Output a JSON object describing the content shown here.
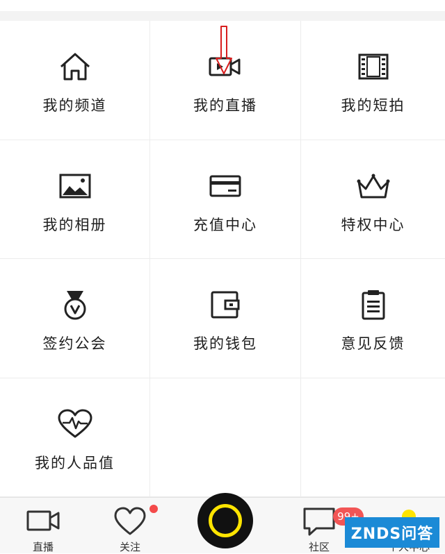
{
  "grid": {
    "items": [
      {
        "label": "我的频道",
        "icon": "home-icon"
      },
      {
        "label": "我的直播",
        "icon": "video-camera-icon"
      },
      {
        "label": "我的短拍",
        "icon": "film-icon"
      },
      {
        "label": "我的相册",
        "icon": "photo-icon"
      },
      {
        "label": "充值中心",
        "icon": "credit-card-icon"
      },
      {
        "label": "特权中心",
        "icon": "crown-icon"
      },
      {
        "label": "签约公会",
        "icon": "medal-icon"
      },
      {
        "label": "我的钱包",
        "icon": "wallet-icon"
      },
      {
        "label": "意见反馈",
        "icon": "clipboard-icon"
      },
      {
        "label": "我的人品值",
        "icon": "heartbeat-icon"
      }
    ]
  },
  "annotation": {
    "color": "#d81e1e",
    "icon": "red-arrow-icon"
  },
  "tabbar": {
    "tabs": [
      {
        "label": "直播",
        "icon": "video-camera-icon"
      },
      {
        "label": "关注",
        "icon": "heart-icon"
      },
      {
        "label": "",
        "icon": "record-button-icon"
      },
      {
        "label": "社区",
        "icon": "chat-bubble-icon"
      },
      {
        "label": "个人中心",
        "icon": "person-icon"
      }
    ],
    "community_badge": "99+",
    "accent": "#ffe400",
    "badge_color": "#f25555"
  },
  "watermark": {
    "text": "ZNDS问答"
  }
}
